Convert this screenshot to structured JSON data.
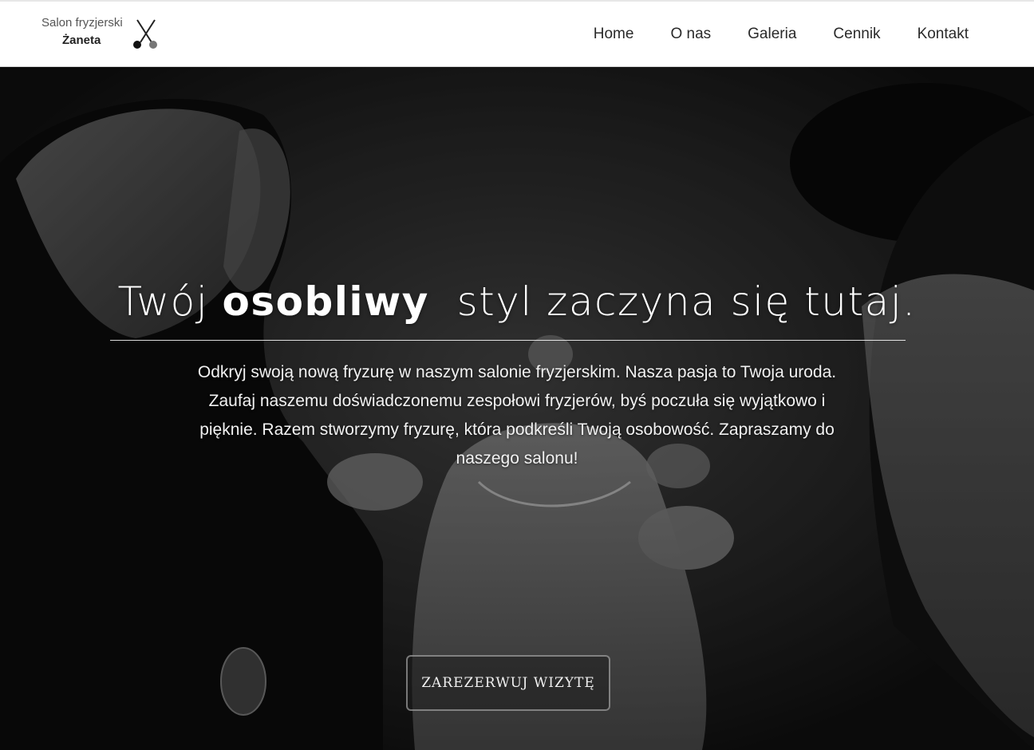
{
  "header": {
    "logo": {
      "line1": "Salon fryzjerski",
      "line2": "Żaneta",
      "icon": "scissors-icon"
    },
    "nav": [
      {
        "label": "Home"
      },
      {
        "label": "O nas"
      },
      {
        "label": "Galeria"
      },
      {
        "label": "Cennik"
      },
      {
        "label": "Kontakt"
      }
    ]
  },
  "hero": {
    "headline_pre": "Twój ",
    "headline_bold": "osobliwy",
    "headline_post": "  styl zaczyna się tutaj.",
    "intro": "Odkryj swoją nową fryzurę w naszym salonie fryzjerskim. Nasza pasja to Twoja uroda. Zaufaj naszemu doświadczonemu zespołowi fryzjerów, byś poczuła się wyjątkowo i pięknie. Razem stworzymy fryzurę, która podkreśli Twoją osobowość. Zapraszamy do naszego salonu!",
    "cta_label": "ZAREZERWUJ WIZYTĘ"
  },
  "colors": {
    "header_bg": "#ffffff",
    "hero_overlay": "#000000",
    "text_light": "#ffffff",
    "nav_text": "#2a2a2a"
  }
}
